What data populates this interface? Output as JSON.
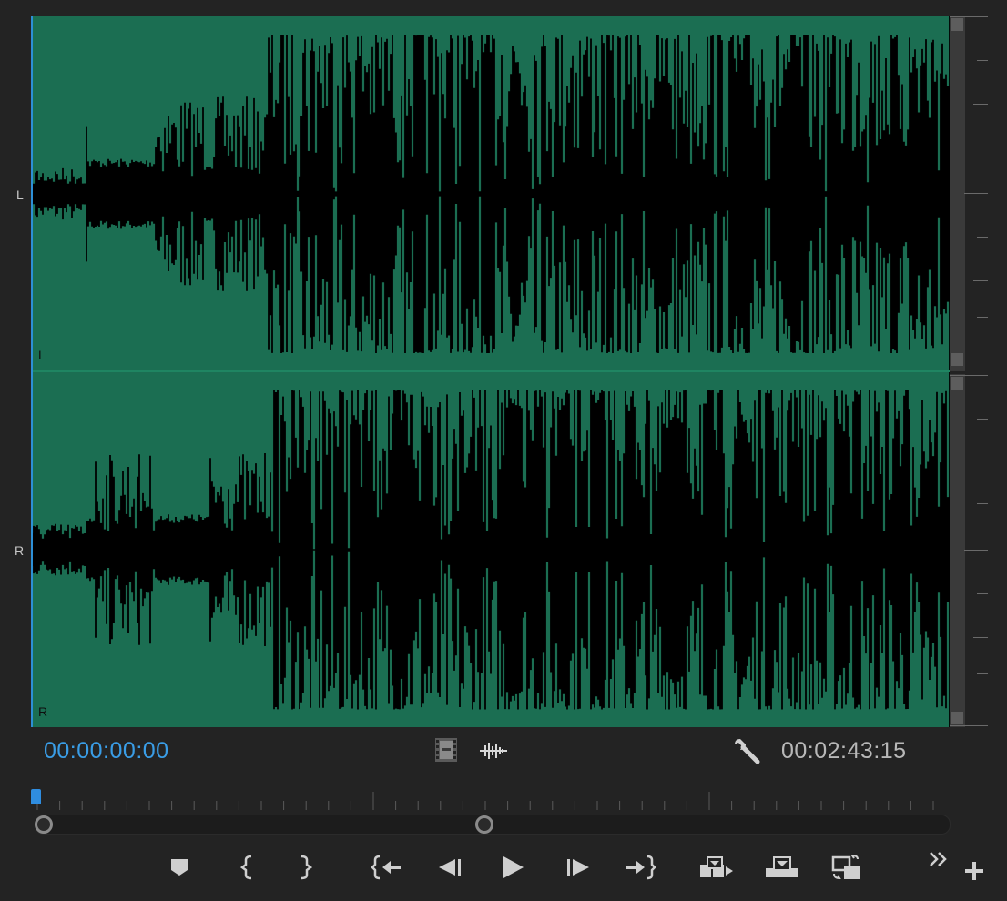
{
  "channels": {
    "left_label": "L",
    "right_label": "R",
    "left_inner_label": "L",
    "right_inner_label": "R"
  },
  "timecodes": {
    "current": "00:00:00:00",
    "duration": "00:02:43:15"
  },
  "toolbar": {
    "icons": [
      "film-strip-icon",
      "audio-waveform-icon",
      "wrench-icon"
    ]
  },
  "controls": {
    "buttons": [
      "add-marker-icon",
      "mark-in-icon",
      "mark-out-icon",
      "go-to-in-icon",
      "step-back-icon",
      "play-icon",
      "step-forward-icon",
      "go-to-out-icon",
      "insert-icon",
      "overwrite-icon",
      "export-frame-icon",
      "more-icon",
      "add-icon"
    ]
  },
  "colors": {
    "waveform": "#1b6e52",
    "accent": "#3a9de6",
    "background": "#232323"
  }
}
